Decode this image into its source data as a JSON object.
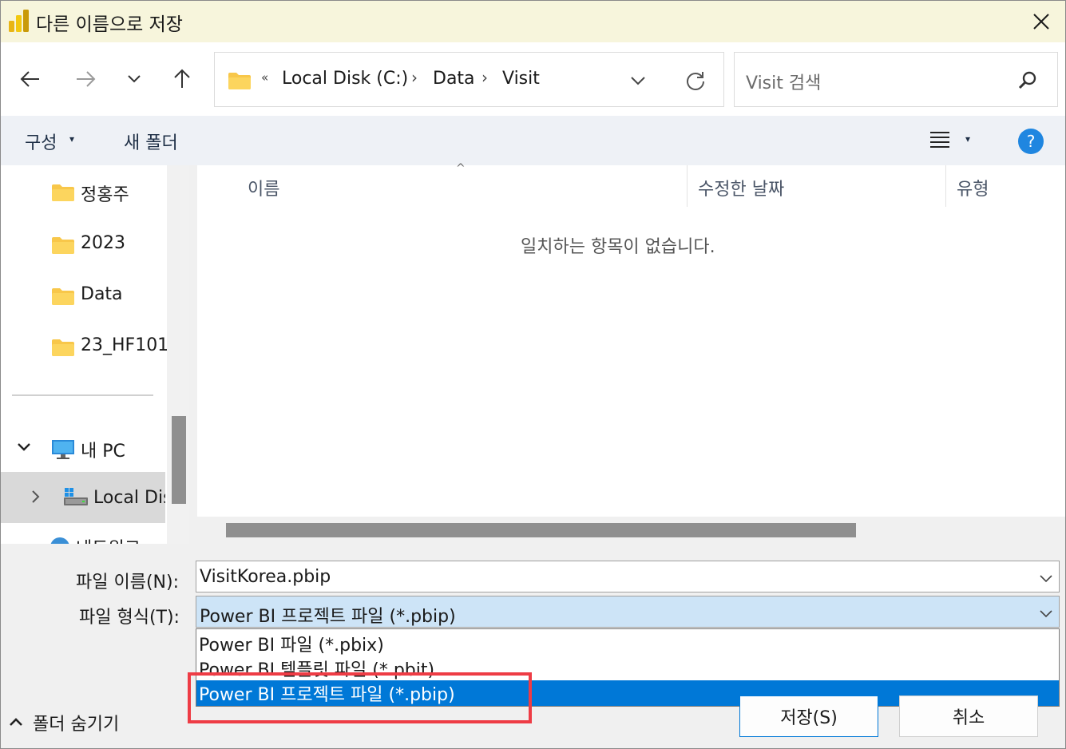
{
  "window": {
    "title": "다른 이름으로 저장",
    "app_icon": "power-bi-icon",
    "close_icon": "close-icon"
  },
  "nav": {
    "back_icon": "arrow-left-icon",
    "forward_icon": "arrow-right-icon",
    "recent_icon": "chevron-down-icon",
    "up_icon": "arrow-up-icon"
  },
  "address": {
    "overflow": "«",
    "segments": [
      "Local Disk (C:)",
      "Data",
      "Visit"
    ],
    "separator": "›",
    "refresh_icon": "refresh-icon"
  },
  "search": {
    "placeholder": "Visit 검색",
    "icon": "search-icon"
  },
  "toolbar": {
    "organize": "구성",
    "new_folder": "새 폴더",
    "view_icon": "view-list-icon",
    "help_icon": "help-icon",
    "help_label": "?"
  },
  "navpane": {
    "items": [
      {
        "label": "정홍주"
      },
      {
        "label": "2023"
      },
      {
        "label": "Data"
      },
      {
        "label": "23_HF101"
      }
    ],
    "this_pc": "내 PC",
    "local_disk": "Local Disk (C:)",
    "network": "네트워크"
  },
  "filelist": {
    "columns": [
      "이름",
      "수정한 날짜",
      "유형"
    ],
    "sort_indicator": "^",
    "empty_message": "일치하는 항목이 없습니다."
  },
  "form": {
    "filename_label": "파일 이름(N):",
    "filename_value": "VisitKorea.pbip",
    "filetype_label": "파일 형식(T):",
    "filetype_value": "Power BI 프로젝트 파일 (*.pbip)",
    "filetype_options": [
      "Power BI 파일 (*.pbix)",
      "Power BI 템플릿 파일 (*.pbit)",
      "Power BI 프로젝트 파일 (*.pbip)"
    ],
    "selected_option_index": 2
  },
  "footer": {
    "hide_folders": "폴더 숨기기",
    "save": "저장(S)",
    "cancel": "취소"
  },
  "colors": {
    "title_bg": "#f7f5dc",
    "toolbar_bg": "#eef1f6",
    "selection": "#0078d7",
    "highlight_box": "#ee3c45",
    "filetype_field_bg": "#cde4f7"
  }
}
